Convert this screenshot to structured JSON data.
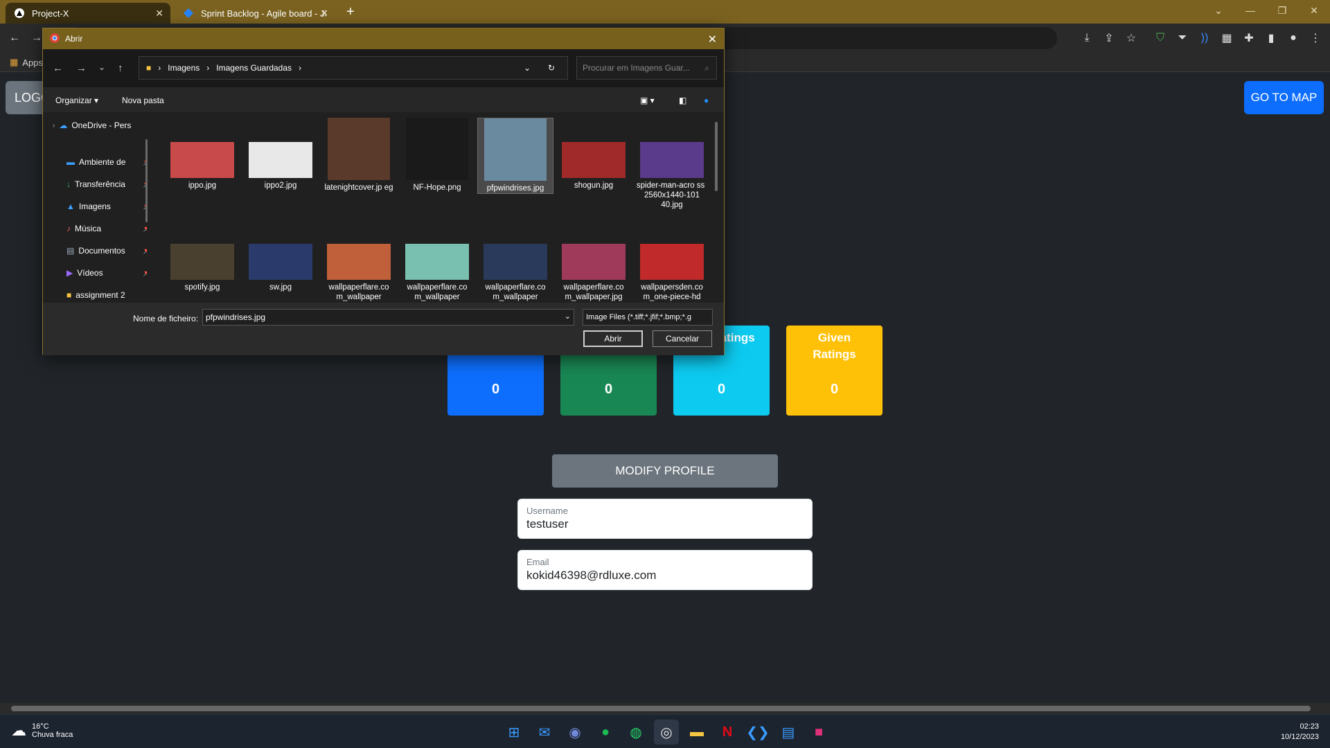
{
  "browser": {
    "tabs": [
      {
        "title": "Project-X"
      },
      {
        "title": "Sprint Backlog - Agile board - Ji"
      }
    ],
    "bookmarks_apps": "Apps"
  },
  "page": {
    "logo_label": "LOGO",
    "goto_map_label": "GO TO MAP",
    "stats": [
      {
        "label": "",
        "value": "0",
        "color": "#0d6efd"
      },
      {
        "label": "",
        "value": "0",
        "color": "#198754"
      },
      {
        "label": "ved Ratings",
        "value": "0",
        "color": "#0dcaf0"
      },
      {
        "label": "Given Ratings",
        "value": "0",
        "color": "#ffc107"
      }
    ],
    "modify_profile_label": "MODIFY PROFILE",
    "username": {
      "label": "Username",
      "value": "testuser"
    },
    "email": {
      "label": "Email",
      "value": "kokid46398@rdluxe.com"
    }
  },
  "dialog": {
    "title": "Abrir",
    "breadcrumb": [
      "Imagens",
      "Imagens Guardadas"
    ],
    "search_placeholder": "Procurar em Imagens Guar...",
    "organize_label": "Organizar",
    "new_folder_label": "Nova pasta",
    "nav_items": [
      {
        "label": "OneDrive - Pers",
        "icon": "onedrive-icon"
      },
      {
        "label": "Ambiente de",
        "icon": "desktop-icon"
      },
      {
        "label": "Transferência",
        "icon": "download-icon"
      },
      {
        "label": "Imagens",
        "icon": "pictures-icon"
      },
      {
        "label": "Música",
        "icon": "music-icon"
      },
      {
        "label": "Documentos",
        "icon": "documents-icon"
      },
      {
        "label": "Vídeos",
        "icon": "videos-icon"
      },
      {
        "label": "assignment 2",
        "icon": "folder-icon"
      }
    ],
    "files": [
      {
        "name": "ippo.jpg",
        "color": "#c94a4a"
      },
      {
        "name": "ippo2.jpg",
        "color": "#e8e8e8"
      },
      {
        "name": "latenightcover.jp eg",
        "color": "#5a3a2a"
      },
      {
        "name": "NF-Hope.png",
        "color": "#1a1a1a"
      },
      {
        "name": "pfpwindrises.jpg",
        "color": "#6a8aa0"
      },
      {
        "name": "shogun.jpg",
        "color": "#a02a2a"
      },
      {
        "name": "spider-man-acro ss-2560x1440-101 40.jpg",
        "color": "#5a3a8a"
      },
      {
        "name": "spotify.jpg",
        "color": "#4a4030"
      },
      {
        "name": "sw.jpg",
        "color": "#2a3a6a"
      },
      {
        "name": "wallpaperflare.co m_wallpaper",
        "color": "#c0603a"
      },
      {
        "name": "wallpaperflare.co m_wallpaper",
        "color": "#7ac0b0"
      },
      {
        "name": "wallpaperflare.co m_wallpaper",
        "color": "#2a3a5a"
      },
      {
        "name": "wallpaperflare.co m_wallpaper.jpg",
        "color": "#a03a5a"
      },
      {
        "name": "wallpapersden.co m_one-piece-hd",
        "color": "#c02a2a"
      }
    ],
    "filename_label": "Nome de ficheiro:",
    "filename_value": "pfpwindrises.jpg",
    "filter_value": "Image Files (*.tiff;*.jfif;*.bmp;*.g",
    "open_label": "Abrir",
    "cancel_label": "Cancelar"
  },
  "taskbar": {
    "weather_temp": "16°C",
    "weather_desc": "Chuva fraca",
    "time": "02:23",
    "date": "10/12/2023"
  }
}
